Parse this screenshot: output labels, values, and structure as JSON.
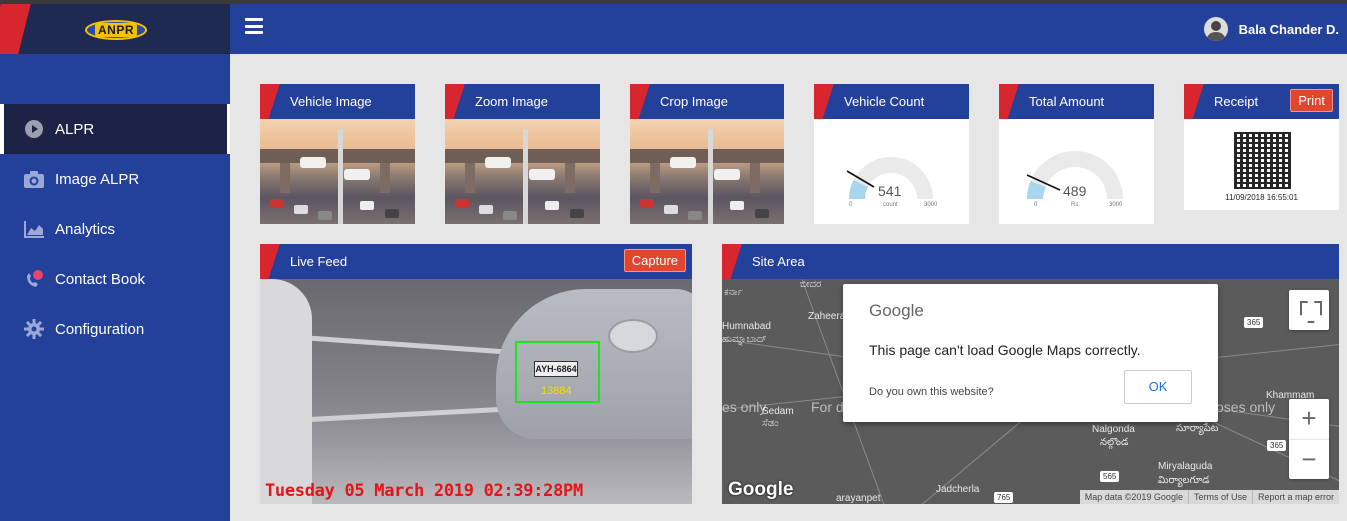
{
  "app": {
    "logo_text": "ANPR",
    "colors": {
      "primary": "#23409a",
      "dark": "#1c2347",
      "accent_red": "#d7262e",
      "button_orange": "#e1452f"
    }
  },
  "header": {
    "user_name": "Bala Chander D.",
    "menu_icon": "hamburger-icon"
  },
  "sidebar": {
    "items": [
      {
        "label": "ALPR",
        "icon": "play-circle-icon",
        "active": true
      },
      {
        "label": "Image ALPR",
        "icon": "camera-icon",
        "active": false
      },
      {
        "label": "Analytics",
        "icon": "area-chart-icon",
        "active": false
      },
      {
        "label": "Contact Book",
        "icon": "phone-contact-icon",
        "active": false
      },
      {
        "label": "Configuration",
        "icon": "gear-icon",
        "active": false
      }
    ]
  },
  "cards": {
    "vehicle_image": {
      "title": "Vehicle Image"
    },
    "zoom_image": {
      "title": "Zoom Image"
    },
    "crop_image": {
      "title": "Crop Image"
    },
    "vehicle_count": {
      "title": "Vehicle Count",
      "value": "541",
      "min": "0",
      "max": "3000",
      "unit": "count"
    },
    "total_amount": {
      "title": "Total Amount",
      "value": "489",
      "min": "0",
      "max": "3000",
      "unit": "Rs."
    },
    "receipt": {
      "title": "Receipt",
      "print_label": "Print",
      "datetime": "11/09/2018 16:55:01"
    }
  },
  "live_feed": {
    "title": "Live Feed",
    "capture_label": "Capture",
    "plate_text": "AYH-6864",
    "detected_number": "13884",
    "timestamp": "Tuesday 05 March 2019 02:39:28PM"
  },
  "site_area": {
    "title": "Site Area",
    "dialog": {
      "brand": "Google",
      "message": "This page can't load Google Maps correctly.",
      "question": "Do you own this website?",
      "ok_label": "OK"
    },
    "map_labels": {
      "humnabad": "Humnabad",
      "humnabad_local": "ಹುಮ್ನಾಬಾದ್",
      "zaheera": "Zaheera",
      "bidar_local": "ಬೀದರ",
      "karnataka_local": "ಕರ್ನಾ",
      "sedam": "Sedam",
      "sedam_local": "ಸೆಡಂ",
      "nalgonda": "Nalgonda",
      "nalgonda_local": "నల్గొండ",
      "suryapet_local": "సూర్యాపేట",
      "khammam": "Khammam",
      "miryalaguda": "Miryalaguda",
      "miryalaguda_local": "మిర్యాలగూడ",
      "jadcherla": "Jadcherla",
      "narayanpet": "arayanpet",
      "overlay_left": "es only",
      "overlay_right": "oses only",
      "overlay_mid": "For d",
      "r365a": "365",
      "r365b": "365",
      "r565": "565",
      "r765": "765"
    },
    "logo": "Google",
    "attribution": [
      "Map data ©2019 Google",
      "Terms of Use",
      "Report a map error"
    ]
  }
}
